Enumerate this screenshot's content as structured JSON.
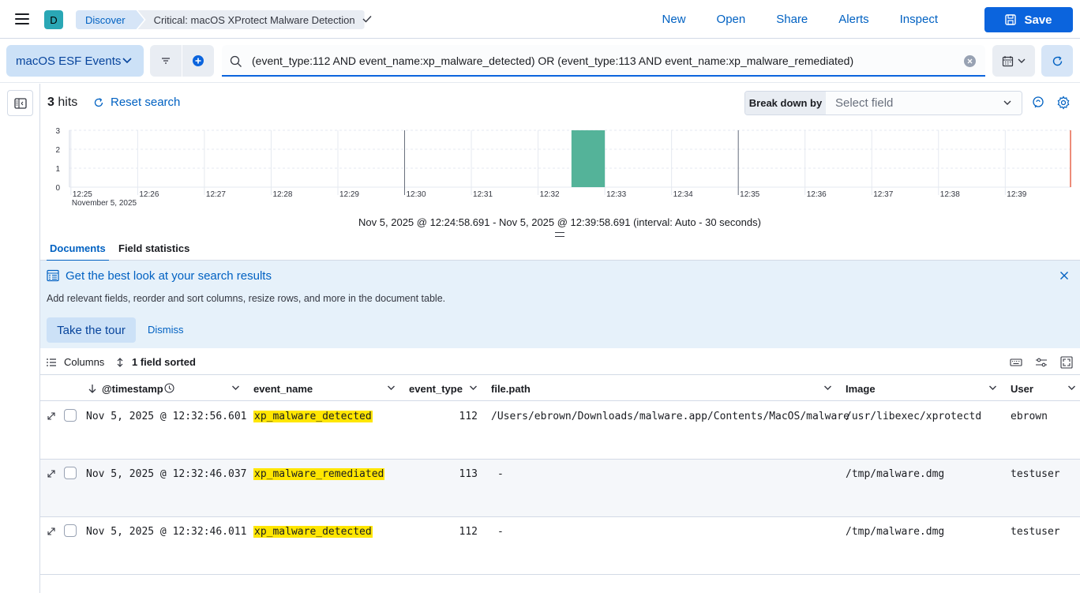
{
  "header": {
    "space_initial": "D",
    "breadcrumbs": [
      "Discover",
      "Critical: macOS XProtect Malware Detection"
    ],
    "links": [
      "New",
      "Open",
      "Share",
      "Alerts",
      "Inspect"
    ],
    "save_label": "Save"
  },
  "querybar": {
    "data_view": "macOS ESF Events",
    "query": "(event_type:112 AND event_name:xp_malware_detected) OR (event_type:113 AND event_name:xp_malware_remediated)"
  },
  "results": {
    "hits_count": "3",
    "hits_label": "hits",
    "reset_label": "Reset search",
    "breakdown_label": "Break down by",
    "breakdown_placeholder": "Select field"
  },
  "chart_data": {
    "type": "bar",
    "x": [
      "12:25",
      "12:26",
      "12:27",
      "12:28",
      "12:29",
      "12:30",
      "12:31",
      "12:32",
      "12:33",
      "12:34",
      "12:35",
      "12:36",
      "12:37",
      "12:38",
      "12:39"
    ],
    "x_sublabel": "November 5, 2025",
    "y_ticks": [
      "0",
      "1",
      "2",
      "3"
    ],
    "ylim": [
      0,
      3
    ],
    "bars": [
      {
        "x_start": "12:32:30",
        "x_end": "12:33:00",
        "value": 3
      }
    ],
    "bar_color": "#54b399",
    "interval_text": "Nov 5, 2025 @ 12:24:58.691 - Nov 5, 2025 @ 12:39:58.691 (interval: Auto - 30 seconds)"
  },
  "tabs": [
    "Documents",
    "Field statistics"
  ],
  "callout": {
    "title": "Get the best look at your search results",
    "body": "Add relevant fields, reorder and sort columns, resize rows, and more in the document table.",
    "tour_label": "Take the tour",
    "dismiss_label": "Dismiss"
  },
  "grid": {
    "columns_label": "Columns",
    "sorted_label": "1 field sorted",
    "headers": [
      "@timestamp",
      "event_name",
      "event_type",
      "file.path",
      "Image",
      "User"
    ],
    "rows": [
      {
        "timestamp": "Nov 5, 2025 @ 12:32:56.601",
        "event_name": "xp_malware_detected",
        "event_type": "112",
        "file_path": "/Users/ebrown/Downloads/malware.app/Contents/MacOS/malware",
        "image": "/usr/libexec/xprotectd",
        "user": "ebrown"
      },
      {
        "timestamp": "Nov 5, 2025 @ 12:32:46.037",
        "event_name": "xp_malware_remediated",
        "event_type": "113",
        "file_path": "-",
        "image": "/tmp/malware.dmg",
        "user": "testuser"
      },
      {
        "timestamp": "Nov 5, 2025 @ 12:32:46.011",
        "event_name": "xp_malware_detected",
        "event_type": "112",
        "file_path": "-",
        "image": "/tmp/malware.dmg",
        "user": "testuser"
      }
    ]
  }
}
